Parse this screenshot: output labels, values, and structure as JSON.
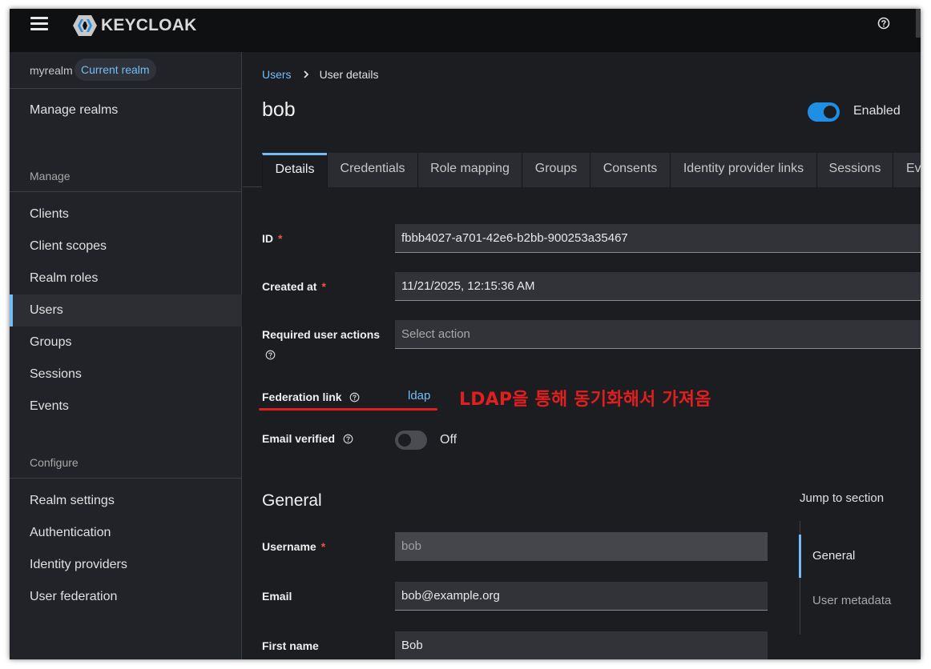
{
  "masthead": {
    "logo_text": "KEYCLOAK",
    "menu_icon": "hamburger-menu-icon",
    "help_icon": "question-circle-icon"
  },
  "sidebar": {
    "realm_name": "myrealm",
    "realm_badge": "Current realm",
    "manage_realms": "Manage realms",
    "manage_section": "Manage",
    "manage_items": [
      {
        "label": "Clients"
      },
      {
        "label": "Client scopes"
      },
      {
        "label": "Realm roles"
      },
      {
        "label": "Users",
        "active": true
      },
      {
        "label": "Groups"
      },
      {
        "label": "Sessions"
      },
      {
        "label": "Events"
      }
    ],
    "configure_section": "Configure",
    "configure_items": [
      {
        "label": "Realm settings"
      },
      {
        "label": "Authentication"
      },
      {
        "label": "Identity providers"
      },
      {
        "label": "User federation"
      }
    ]
  },
  "breadcrumb": {
    "parent": "Users",
    "current": "User details"
  },
  "page": {
    "title": "bob",
    "enabled_label": "Enabled",
    "enabled": true
  },
  "tabs": [
    {
      "label": "Details",
      "active": true
    },
    {
      "label": "Credentials"
    },
    {
      "label": "Role mapping"
    },
    {
      "label": "Groups"
    },
    {
      "label": "Consents"
    },
    {
      "label": "Identity provider links"
    },
    {
      "label": "Sessions"
    },
    {
      "label": "Events"
    }
  ],
  "form": {
    "id_label": "ID",
    "id_value": "fbbb4027-a701-42e6-b2bb-900253a35467",
    "created_label": "Created at",
    "created_value": "11/21/2025, 12:15:36 AM",
    "actions_label": "Required user actions",
    "actions_placeholder": "Select action",
    "federation_label": "Federation link",
    "federation_value": "ldap",
    "email_verified_label": "Email verified",
    "email_verified_state": "Off",
    "required_mark": "*"
  },
  "annotation": "LDAP을 통해 동기화해서 가져옴",
  "general": {
    "heading": "General",
    "username_label": "Username",
    "username_value": "bob",
    "email_label": "Email",
    "email_value": "bob@example.org",
    "first_name_label": "First name",
    "first_name_value": "Bob"
  },
  "jump": {
    "title": "Jump to section",
    "links": [
      {
        "label": "General",
        "active": true
      },
      {
        "label": "User metadata"
      }
    ]
  },
  "colors": {
    "accent": "#73bcf7",
    "toggle_on": "#1f8fe5",
    "annotation_red": "#e11f1f",
    "required_red": "#f0523d"
  }
}
